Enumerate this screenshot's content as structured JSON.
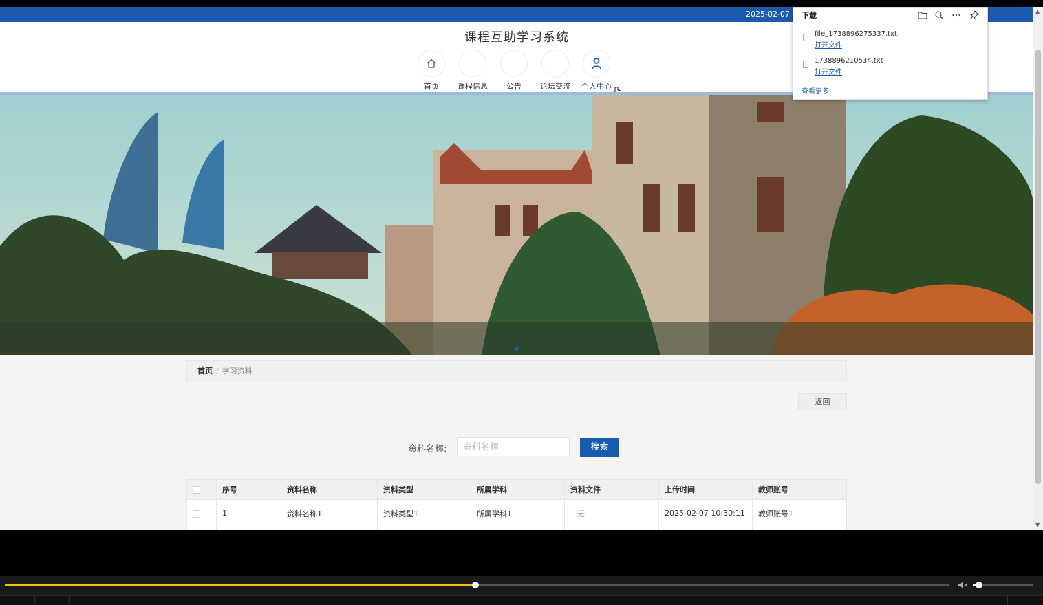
{
  "topbar": {
    "date": "2025-02-07"
  },
  "header": {
    "title": "课程互助学习系统",
    "nav": [
      {
        "label": "首页",
        "icon": "home-icon"
      },
      {
        "label": "课程信息",
        "icon": ""
      },
      {
        "label": "公告",
        "icon": ""
      },
      {
        "label": "论坛交流",
        "icon": ""
      },
      {
        "label": "个人中心",
        "icon": "user-icon",
        "active": true
      }
    ]
  },
  "breadcrumb": {
    "home": "首页",
    "separator": "/",
    "current": "学习资料"
  },
  "back_label": "返回",
  "search": {
    "label": "资料名称:",
    "placeholder": "资料名称",
    "value": "",
    "button": "搜索"
  },
  "table": {
    "headers": [
      "序号",
      "资料名称",
      "资料类型",
      "所属学科",
      "资料文件",
      "上传时间",
      "教师账号"
    ],
    "rows": [
      [
        "1",
        "资料名称1",
        "资料类型1",
        "所属学科1",
        "无",
        "2025-02-07 10:30:11",
        "教师账号1"
      ]
    ]
  },
  "downloads": {
    "title": "下载",
    "files": [
      {
        "name": "file_1738896275337.txt",
        "action": "打开文件"
      },
      {
        "name": "1738896210534.txt",
        "action": "打开文件"
      }
    ],
    "more": "查看更多"
  },
  "player": {
    "progress": 0.498,
    "volume": 0.1
  },
  "colors": {
    "accent": "#1a5bb0",
    "seek": "#f2c200"
  }
}
